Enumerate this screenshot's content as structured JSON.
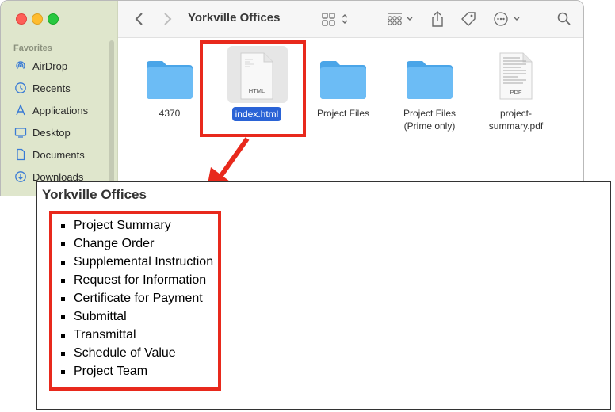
{
  "finder": {
    "title": "Yorkville Offices",
    "sidebar": {
      "heading": "Favorites",
      "items": [
        {
          "label": "AirDrop",
          "icon": "airdrop-icon"
        },
        {
          "label": "Recents",
          "icon": "clock-icon"
        },
        {
          "label": "Applications",
          "icon": "applications-icon"
        },
        {
          "label": "Desktop",
          "icon": "desktop-icon"
        },
        {
          "label": "Documents",
          "icon": "document-icon"
        },
        {
          "label": "Downloads",
          "icon": "download-icon"
        }
      ]
    },
    "files": [
      {
        "name": "4370",
        "type": "folder"
      },
      {
        "name": "index.html",
        "type": "html",
        "badge": "HTML",
        "selected": true
      },
      {
        "name": "Project Files",
        "type": "folder"
      },
      {
        "name": "Project Files (Prime only)",
        "type": "folder"
      },
      {
        "name": "project-summary.pdf",
        "type": "pdf",
        "badge": "PDF"
      }
    ],
    "colors": {
      "folder": "#5bb4f2",
      "selection": "#2a63d6",
      "sidebar_bg": "#dfe6cc"
    }
  },
  "page": {
    "heading": "Yorkville Offices",
    "links": [
      "Project Summary",
      "Change Order",
      "Supplemental Instruction",
      "Request for Information",
      "Certificate for Payment",
      "Submittal",
      "Transmittal",
      "Schedule of Value",
      "Project Team"
    ]
  },
  "annotation": {
    "color": "#e8291c"
  }
}
